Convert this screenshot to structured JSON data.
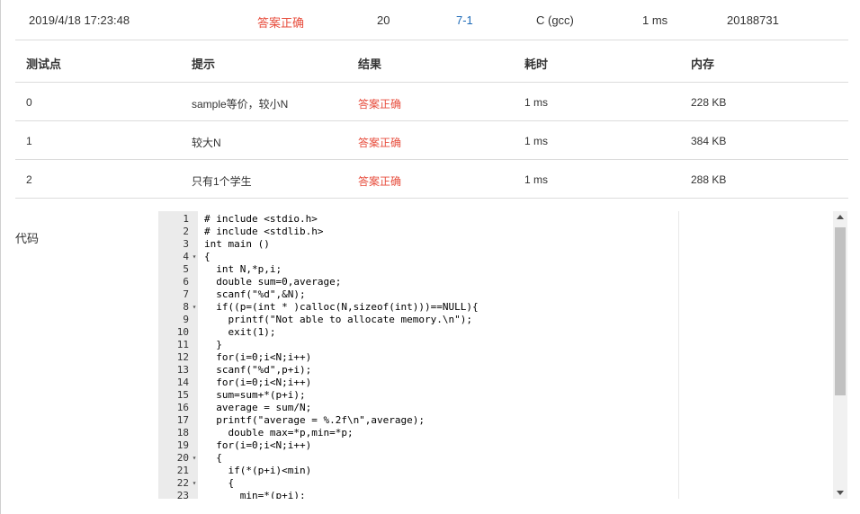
{
  "summary": {
    "submit_time": "2019/4/18 17:23:48",
    "status": "答案正确",
    "score": "20",
    "problem": "7-1",
    "compiler": "C (gcc)",
    "time": "1 ms",
    "user": "20188731"
  },
  "table": {
    "headers": [
      "测试点",
      "提示",
      "结果",
      "耗时",
      "内存"
    ],
    "rows": [
      [
        "0",
        "sample等价，较小N",
        "答案正确",
        "1 ms",
        "228 KB"
      ],
      [
        "1",
        "较大N",
        "答案正确",
        "1 ms",
        "384 KB"
      ],
      [
        "2",
        "只有1个学生",
        "答案正确",
        "1 ms",
        "288 KB"
      ]
    ]
  },
  "code_label": "代码",
  "code_lines": [
    {
      "n": "1",
      "fold": "",
      "text": "# include <stdio.h>"
    },
    {
      "n": "2",
      "fold": "",
      "text": "# include <stdlib.h>"
    },
    {
      "n": "3",
      "fold": "",
      "text": "int main ()"
    },
    {
      "n": "4",
      "fold": "▾",
      "text": "{"
    },
    {
      "n": "5",
      "fold": "",
      "text": "  int N,*p,i;"
    },
    {
      "n": "6",
      "fold": "",
      "text": "  double sum=0,average;"
    },
    {
      "n": "7",
      "fold": "",
      "text": "  scanf(\"%d\",&N);"
    },
    {
      "n": "8",
      "fold": "▾",
      "text": "  if((p=(int * )calloc(N,sizeof(int)))==NULL){"
    },
    {
      "n": "9",
      "fold": "",
      "text": "    printf(\"Not able to allocate memory.\\n\");"
    },
    {
      "n": "10",
      "fold": "",
      "text": "    exit(1);"
    },
    {
      "n": "11",
      "fold": "",
      "text": "  }"
    },
    {
      "n": "12",
      "fold": "",
      "text": "  for(i=0;i<N;i++)"
    },
    {
      "n": "13",
      "fold": "",
      "text": "  scanf(\"%d\",p+i);"
    },
    {
      "n": "14",
      "fold": "",
      "text": "  for(i=0;i<N;i++)"
    },
    {
      "n": "15",
      "fold": "",
      "text": "  sum=sum+*(p+i);"
    },
    {
      "n": "16",
      "fold": "",
      "text": "  average = sum/N;"
    },
    {
      "n": "17",
      "fold": "",
      "text": "  printf(\"average = %.2f\\n\",average);"
    },
    {
      "n": "18",
      "fold": "",
      "text": "    double max=*p,min=*p;"
    },
    {
      "n": "19",
      "fold": "",
      "text": "  for(i=0;i<N;i++)"
    },
    {
      "n": "20",
      "fold": "▾",
      "text": "  {"
    },
    {
      "n": "21",
      "fold": "",
      "text": "    if(*(p+i)<min)"
    },
    {
      "n": "22",
      "fold": "▾",
      "text": "    {"
    },
    {
      "n": "23",
      "fold": "",
      "text": "      min=*(p+i);"
    }
  ]
}
